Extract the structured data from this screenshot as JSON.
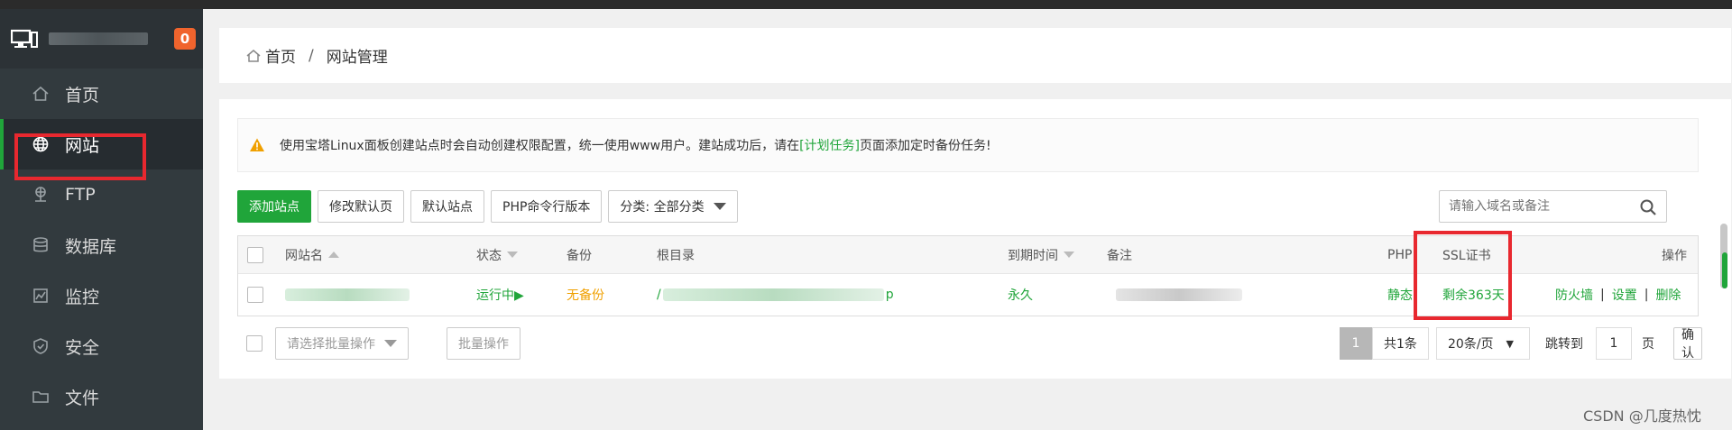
{
  "sidebar": {
    "badge": "0",
    "items": [
      {
        "label": "首页",
        "icon": "home-icon"
      },
      {
        "label": "网站",
        "icon": "globe-icon",
        "active": true
      },
      {
        "label": "FTP",
        "icon": "ftp-icon"
      },
      {
        "label": "数据库",
        "icon": "database-icon"
      },
      {
        "label": "监控",
        "icon": "monitor-icon"
      },
      {
        "label": "安全",
        "icon": "shield-icon"
      },
      {
        "label": "文件",
        "icon": "folder-icon"
      }
    ]
  },
  "breadcrumb": {
    "home": "首页",
    "sep": "/",
    "current": "网站管理"
  },
  "alert": {
    "text_before": "使用宝塔Linux面板创建站点时会自动创建权限配置，统一使用www用户。建站成功后，请在",
    "link": "[计划任务]",
    "text_after": "页面添加定时备份任务!"
  },
  "toolbar": {
    "add_site": "添加站点",
    "edit_default_page": "修改默认页",
    "default_site": "默认站点",
    "php_cli_version": "PHP命令行版本",
    "category": "分类: 全部分类"
  },
  "search": {
    "placeholder": "请输入域名或备注"
  },
  "table": {
    "headers": {
      "name": "网站名",
      "status": "状态",
      "backup": "备份",
      "root": "根目录",
      "expire": "到期时间",
      "remark": "备注",
      "php": "PHP",
      "ssl": "SSL证书",
      "ops": "操作"
    },
    "rows": [
      {
        "status": "运行中▶",
        "backup": "无备份",
        "root_prefix": "/",
        "root_suffix": "p",
        "expire": "永久",
        "php": "静态",
        "ssl": "剩余363天",
        "op_firewall": "防火墙",
        "op_sep": "|",
        "op_settings": "设置",
        "op_delete": "删除"
      }
    ]
  },
  "footer": {
    "batch_select": "请选择批量操作",
    "batch_btn": "批量操作",
    "page_current": "1",
    "total": "共1条",
    "per_page": "20条/页",
    "jump_to": "跳转到",
    "jump_value": "1",
    "page_unit": "页",
    "confirm": "确认"
  },
  "watermark": "CSDN @几度热忱",
  "colors": {
    "accent": "#20a53a",
    "sidebar_bg": "#323a3e",
    "highlight": "#e8282f",
    "warning": "#f0a000"
  }
}
